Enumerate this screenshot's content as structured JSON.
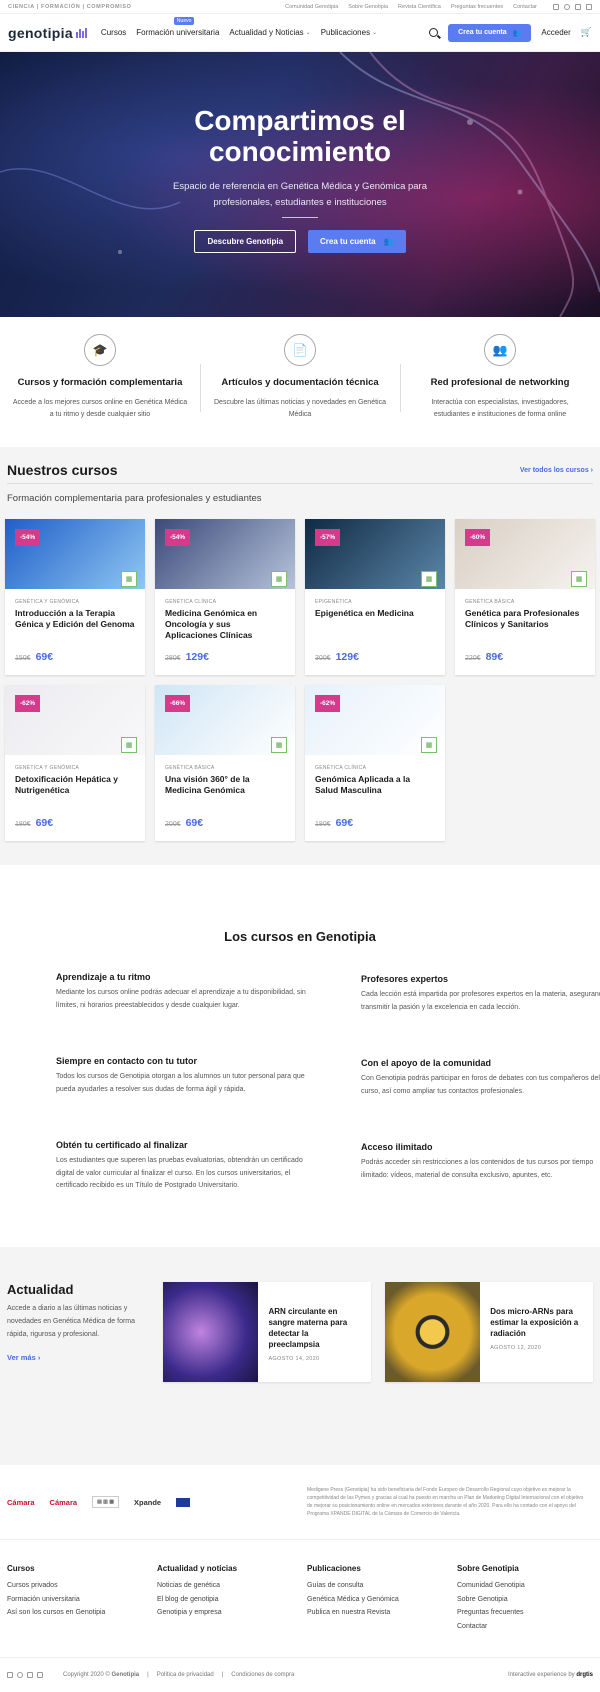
{
  "topbar": {
    "tagline": "CIENCIA | FORMACIÓN | COMPROMISO",
    "links": [
      "Comunidad Genotipia",
      "Sobre Genotipia",
      "Revista Científica",
      "Preguntas frecuentes",
      "Contactar"
    ]
  },
  "nav": {
    "logo": "genotipia",
    "items": [
      {
        "label": "Cursos"
      },
      {
        "label": "Formación universitaria",
        "badge": "Nuevo"
      },
      {
        "label": "Actualidad y Noticias"
      },
      {
        "label": "Publicaciones"
      }
    ],
    "create_account": "Crea tu cuenta",
    "login": "Acceder"
  },
  "hero": {
    "title": "Compartimos el conocimiento",
    "subtitle": "Espacio de referencia en Genética Médica y Genómica para profesionales, estudiantes e instituciones",
    "btn_discover": "Descubre Genotipia",
    "btn_create": "Crea tu cuenta"
  },
  "features": [
    {
      "icon": "graduation-cap-icon",
      "title": "Cursos y formación complementaria",
      "text": "Accede a los mejores cursos online en Genética Médica a tu ritmo y desde cualquier sitio"
    },
    {
      "icon": "document-icon",
      "title": "Artículos y documentación técnica",
      "text": "Descubre las últimas noticias y novedades en Genética Médica"
    },
    {
      "icon": "users-icon",
      "title": "Red profesional de networking",
      "text": "Interactúa con especialistas, investigadores, estudiantes e instituciones de forma online"
    }
  ],
  "courses": {
    "title": "Nuestros cursos",
    "see_all": "Ver todos los cursos",
    "subtitle": "Formación complementaria para profesionales y estudiantes",
    "items": [
      {
        "discount": "-54%",
        "category": "GENÉTICA Y GENÓMICA",
        "title": "Introducción a la Terapia Génica y Edición del Genoma",
        "old": "150€",
        "new": "69€",
        "color1": "#1f5ec9",
        "color2": "#8fc7f2"
      },
      {
        "discount": "-54%",
        "category": "GENÉTICA CLÍNICA",
        "title": "Medicina Genómica en Oncología y sus Aplicaciones Clínicas",
        "old": "280€",
        "new": "129€",
        "color1": "#3a4a7a",
        "color2": "#b7c3da"
      },
      {
        "discount": "-57%",
        "category": "EPIGENÉTICA",
        "title": "Epigenética en Medicina",
        "old": "300€",
        "new": "129€",
        "color1": "#0f2a44",
        "color2": "#5c86a8"
      },
      {
        "discount": "-60%",
        "category": "GENÉTICA BÁSICA",
        "title": "Genética para Profesionales Clínicos y Sanitarios",
        "old": "220€",
        "new": "89€",
        "color1": "#d9cfc4",
        "color2": "#f5f2ee"
      },
      {
        "discount": "-62%",
        "category": "GENÉTICA Y GENÓMICA",
        "title": "Detoxificación Hepática y Nutrigenética",
        "old": "180€",
        "new": "69€",
        "color1": "#ececf0",
        "color2": "#f8f8fa"
      },
      {
        "discount": "-66%",
        "category": "GENÉTICA BÁSICA",
        "title": "Una visión 360° de la Medicina Genómica",
        "old": "200€",
        "new": "69€",
        "color1": "#cfe6f5",
        "color2": "#ffffff"
      },
      {
        "discount": "-62%",
        "category": "GENÉTICA CLÍNICA",
        "title": "Genómica Aplicada a la Salud Masculina",
        "old": "180€",
        "new": "69€",
        "color1": "#e6f1fb",
        "color2": "#ffffff"
      }
    ]
  },
  "why": {
    "title": "Los cursos en Genotipia",
    "left": [
      {
        "title": "Aprendizaje a tu ritmo",
        "text": "Mediante los cursos online podrás adecuar el aprendizaje a tu disponibilidad, sin límites, ni horarios preestablecidos y desde cualquier lugar."
      },
      {
        "title": "Siempre en contacto con tu tutor",
        "text": "Todos los cursos de Genotipia otorgan a los alumnos un tutor personal para que pueda ayudarles a resolver sus dudas de forma ágil y rápida."
      },
      {
        "title": "Obtén tu certificado al finalizar",
        "text": "Los estudiantes que superen las pruebas evaluatorias, obtendrán un certificado digital de valor curricular al finalizar el curso. En los cursos universitarios, el certificado recibido es un Título de Postgrado Universitario."
      }
    ],
    "right": [
      {
        "title": "Profesores expertos",
        "text": "Cada lección está impartida por profesores expertos en la materia, asegurando transmitir la pasión y la excelencia en cada lección."
      },
      {
        "title": "Con el apoyo de la comunidad",
        "text": "Con Genotipia podrás participar en foros de debates con tus compañeros del curso, así como ampliar tus contactos profesionales."
      },
      {
        "title": "Acceso ilimitado",
        "text": "Podrás acceder sin restricciones a los contenidos de tus cursos por tiempo ilimitado: vídeos, material de consulta exclusivo, apuntes, etc."
      }
    ]
  },
  "news": {
    "title": "Actualidad",
    "text": "Accede a diario a las últimas noticias y novedades en Genética Médica de forma rápida, rigurosa y profesional.",
    "more": "Ver más",
    "items": [
      {
        "title": "ARN circulante en sangre materna para detectar la preeclampsia",
        "date": "AGOSTO 14, 2020"
      },
      {
        "title": "Dos micro-ARNs para estimar la exposición a radiación",
        "date": "AGOSTO 12, 2020"
      }
    ]
  },
  "partners": {
    "logos": [
      "Cámara",
      "Cámara",
      "Xpande"
    ],
    "note": "Medigene Press (Genotipia) ha sido beneficiaria del Fondo Europeo de Desarrollo Regional cuyo objetivo es mejorar la competitividad de las Pymes y gracias al cual ha puesto en marcha un Plan de Marketing Digital Internacional con el objetivo de mejorar su posicionamiento online en mercados exteriores durante el año 2020. Para ello ha contado con el apoyo del Programa XPANDE DIGITAL de la Cámara de Comercio de Valencia."
  },
  "footer": {
    "cols": [
      {
        "title": "Cursos",
        "items": [
          "Cursos privados",
          "Formación universitaria",
          "Así son los cursos en Genotipia"
        ]
      },
      {
        "title": "Actualidad y noticias",
        "items": [
          "Noticias de genética",
          "El blog de genotipia",
          "Genotipia y empresa"
        ]
      },
      {
        "title": "Publicaciones",
        "items": [
          "Guías de consulta",
          "Genética Médica y Genómica",
          "Publica en nuestra Revista"
        ]
      },
      {
        "title": "Sobre Genotipia",
        "items": [
          "Comunidad Genotipia",
          "Sobre Genotipia",
          "Preguntas frecuentes",
          "Contactar"
        ]
      }
    ],
    "copyright_prefix": "Copyright 2020 ©",
    "copyright_brand": "Genotipia",
    "privacy": "Política de privacidad",
    "terms": "Condiciones de compra",
    "credit_prefix": "Interactive experience by",
    "credit_brand": "drgtis"
  }
}
